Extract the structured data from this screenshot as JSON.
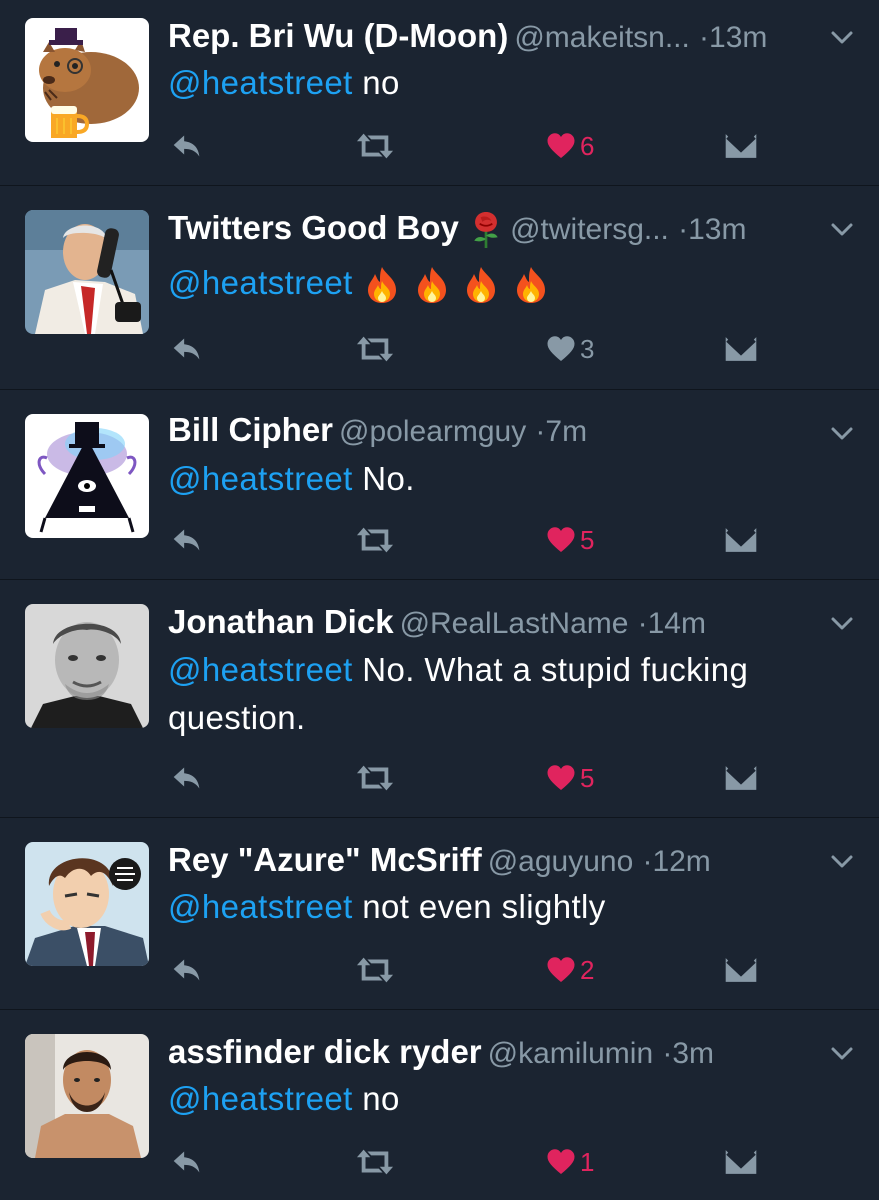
{
  "colors": {
    "background": "#1b2431",
    "mention": "#1da1f2",
    "muted": "#8899a6",
    "like": "#e0245e"
  },
  "tweets": [
    {
      "name": "Rep. Bri Wu (D-Moon)",
      "handle": "@makeitsn...",
      "time": "13m",
      "mention": "@heatstreet",
      "text": "no",
      "likes": "6",
      "liked": true,
      "avatar": "beaver-with-hat-and-beer-icon"
    },
    {
      "name": "Twitters Good Boy",
      "name_emoji": "rose-icon",
      "handle": "@twitersg...",
      "time": "13m",
      "mention": "@heatstreet",
      "text": "",
      "text_emoji": [
        "fire-icon",
        "fire-icon",
        "fire-icon",
        "fire-icon"
      ],
      "likes": "3",
      "liked": false,
      "avatar": "man-on-phone-photo"
    },
    {
      "name": "Bill Cipher",
      "handle": "@polearmguy",
      "time": "7m",
      "mention": "@heatstreet",
      "text": "No.",
      "likes": "5",
      "liked": true,
      "avatar": "triangle-character-icon"
    },
    {
      "name": "Jonathan Dick",
      "handle": "@RealLastName",
      "time": "14m",
      "mention": "@heatstreet",
      "text": "No. What a stupid fucking question.",
      "likes": "5",
      "liked": true,
      "avatar": "man-portrait-photo"
    },
    {
      "name": "Rey \"Azure\" McSriff",
      "handle": "@aguyuno",
      "time": "12m",
      "mention": "@heatstreet",
      "text": "not even slightly",
      "likes": "2",
      "liked": true,
      "avatar": "anime-character-icon"
    },
    {
      "name": "assfinder dick ryder",
      "handle": "@kamilumin",
      "time": "3m",
      "mention": "@heatstreet",
      "text": "no",
      "likes": "1",
      "liked": true,
      "avatar": "shirtless-man-photo"
    }
  ],
  "separator": "·"
}
